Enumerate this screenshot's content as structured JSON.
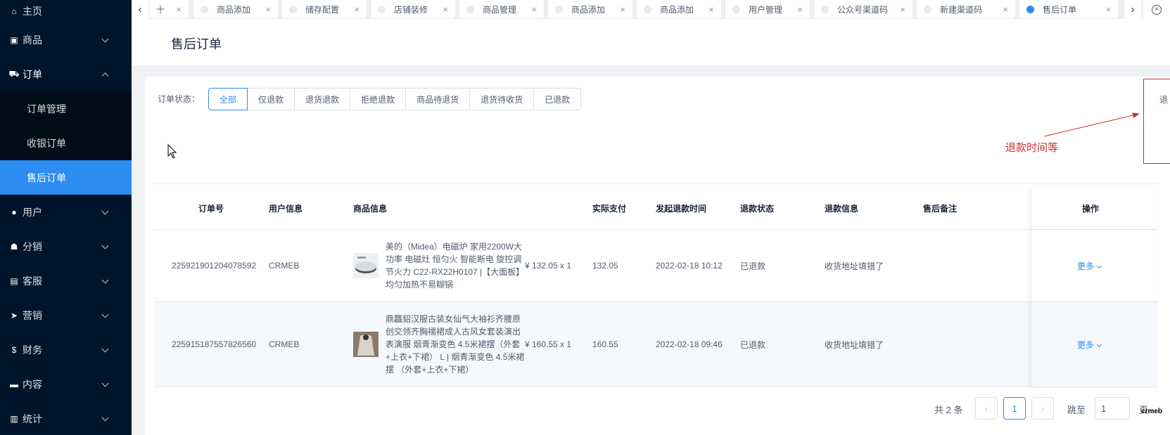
{
  "sidebar": {
    "items": [
      {
        "label": "主页",
        "icon": "home-icon",
        "glyph": "⌂"
      },
      {
        "label": "商品",
        "icon": "shop-icon",
        "glyph": "▣"
      },
      {
        "label": "订单",
        "icon": "cart-icon",
        "glyph": "⛟"
      },
      {
        "label": "用户",
        "icon": "user-icon",
        "glyph": "●"
      },
      {
        "label": "分销",
        "icon": "distribution-icon",
        "glyph": "☗"
      },
      {
        "label": "客服",
        "icon": "service-icon",
        "glyph": "▤"
      },
      {
        "label": "营销",
        "icon": "send-icon",
        "glyph": "➤"
      },
      {
        "label": "财务",
        "icon": "dollar-icon",
        "glyph": "$"
      },
      {
        "label": "内容",
        "icon": "book-icon",
        "glyph": "▬"
      },
      {
        "label": "统计",
        "icon": "chart-icon",
        "glyph": "▥"
      }
    ],
    "order_sub": [
      "订单管理",
      "收银订单",
      "售后订单"
    ]
  },
  "tabs": [
    {
      "label": "十"
    },
    {
      "label": "商品添加"
    },
    {
      "label": "储存配置"
    },
    {
      "label": "店铺装修"
    },
    {
      "label": "商品管理"
    },
    {
      "label": "商品添加"
    },
    {
      "label": "商品添加"
    },
    {
      "label": "用户管理"
    },
    {
      "label": "公众号渠道码"
    },
    {
      "label": "新建渠道码"
    },
    {
      "label": "售后订单"
    }
  ],
  "page": {
    "title": "售后订单"
  },
  "filter": {
    "label": "订单状态：",
    "options": [
      "全部",
      "仅退款",
      "退货退款",
      "拒绝退款",
      "商品待退货",
      "退货待收货",
      "已退款"
    ]
  },
  "annotation": {
    "text": "退款时间等",
    "fragment": "退"
  },
  "table": {
    "headers": [
      "订单号",
      "用户信息",
      "商品信息",
      "实际支付",
      "发起退款时间",
      "退款状态",
      "退款信息",
      "售后备注",
      "操作"
    ],
    "rows": [
      {
        "order_no": "225921901204078592",
        "user": "CRMEB",
        "product": "美的（Midea）电磁炉 家用2200W大功率 电磁灶 恒匀火 智能断电 旋控调节火力 C22-RX22H0107 |【大面板】均匀加热不易糊锅",
        "price_qty": "¥ 132.05 x 1",
        "paid": "132.05",
        "refund_time": "2022-02-18 10:12",
        "status": "已退款",
        "refund_info": "收货地址填错了",
        "remark": "",
        "action": "更多"
      },
      {
        "order_no": "225915187557826560",
        "user": "CRMEB",
        "product": "鼎龘貂汉服古装女仙气大袖衫齐腰原创交领齐胸襦裙成人古风女套装演出表演服 烟青渐变色 4.5米裙摆（外套+上衣+下裙） L | 烟青渐变色 4.5米裙摆 （外套+上衣+下裙）",
        "price_qty": "¥ 160.55 x 1",
        "paid": "160.55",
        "refund_time": "2022-02-18 09:46",
        "status": "已退款",
        "refund_info": "收货地址填错了",
        "remark": "",
        "action": "更多"
      }
    ]
  },
  "pagination": {
    "total": "共 2 条",
    "current": "1",
    "jump_label": "跳至",
    "jump_value": "1",
    "page_suffix": "页"
  },
  "watermark": "crmeb",
  "colors": {
    "sidebar_bg": "#001529",
    "accent": "#2d8cf0",
    "annotation": "#c9302c"
  }
}
